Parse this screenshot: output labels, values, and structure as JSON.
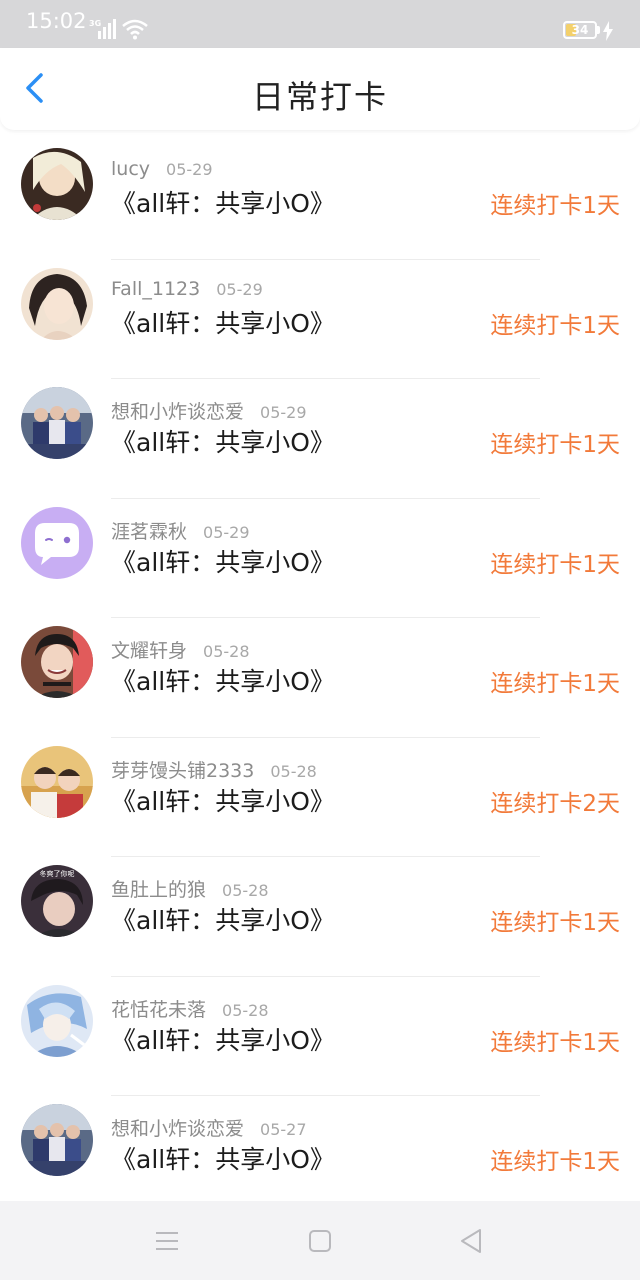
{
  "status_bar": {
    "time": "15:02",
    "network": "3G",
    "battery": "34",
    "battery_level": 0.34
  },
  "header": {
    "title": "日常打卡",
    "back_icon": "chevron-left-icon",
    "accent_color": "#2b8ff5"
  },
  "checkins": [
    {
      "username": "lucy",
      "date": "05-29",
      "topic": "《all轩：共享小O》",
      "streak": "连续打卡1天",
      "avatar": "avatar-girl-blonde"
    },
    {
      "username": "Fall_1123",
      "date": "05-29",
      "topic": "《all轩：共享小O》",
      "streak": "连续打卡1天",
      "avatar": "avatar-girl-dark-hair"
    },
    {
      "username": "想和小炸谈恋爱",
      "date": "05-29",
      "topic": "《all轩：共享小O》",
      "streak": "连续打卡1天",
      "avatar": "avatar-group-photo"
    },
    {
      "username": "涯茗霖秋",
      "date": "05-29",
      "topic": "《all轩：共享小O》",
      "streak": "连续打卡1天",
      "avatar": "avatar-chat-bubble-purple"
    },
    {
      "username": "文耀轩身",
      "date": "05-28",
      "topic": "《all轩：共享小O》",
      "streak": "连续打卡1天",
      "avatar": "avatar-boy-smiling"
    },
    {
      "username": "芽芽馒头铺2333",
      "date": "05-28",
      "topic": "《all轩：共享小O》",
      "streak": "连续打卡2天",
      "avatar": "avatar-two-boys"
    },
    {
      "username": "鱼肚上的狼",
      "date": "05-28",
      "topic": "《all轩：共享小O》",
      "streak": "连续打卡1天",
      "avatar": "avatar-boy-caption"
    },
    {
      "username": "花恬花未落",
      "date": "05-28",
      "topic": "《all轩：共享小O》",
      "streak": "连续打卡1天",
      "avatar": "avatar-anime-blue"
    },
    {
      "username": "想和小炸谈恋爱",
      "date": "05-27",
      "topic": "《all轩：共享小O》",
      "streak": "连续打卡1天",
      "avatar": "avatar-group-photo"
    }
  ],
  "avatar_caption": "冬爽了你呢",
  "colors": {
    "streak": "#f27a3a",
    "username": "#8c8c8c",
    "status_bar": "#d7d7d9",
    "nav_bar": "#f3f3f5"
  },
  "nav_bar": {
    "menu_icon": "menu-icon",
    "home_icon": "square-home-icon",
    "back_icon": "triangle-back-icon"
  }
}
